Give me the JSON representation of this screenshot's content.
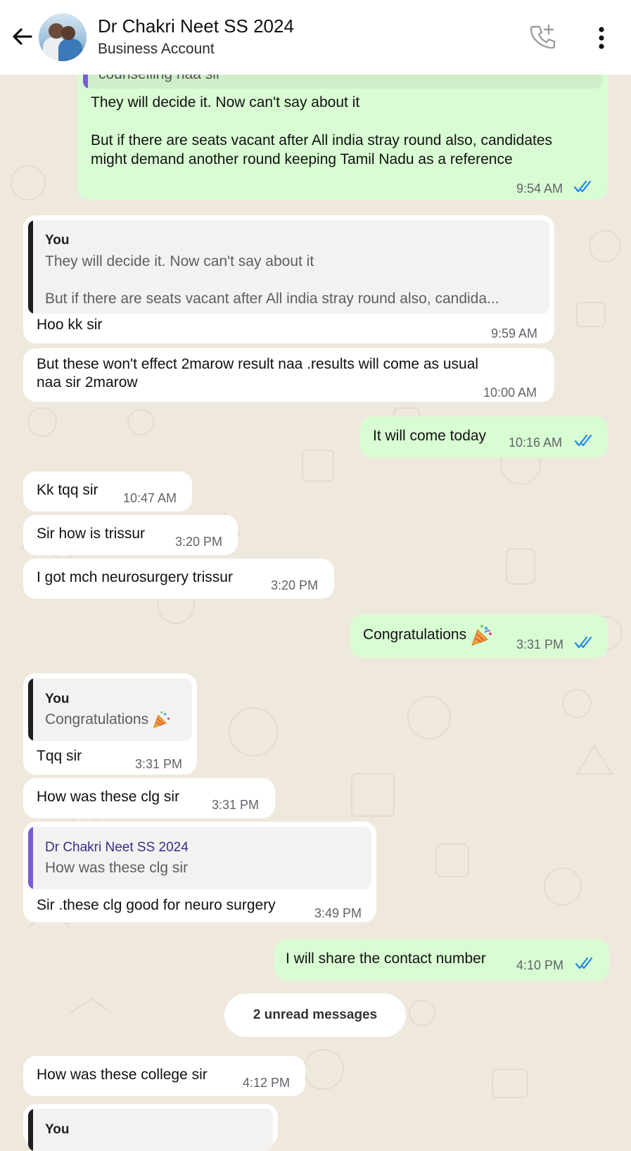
{
  "header": {
    "title": "Dr Chakri Neet SS 2024",
    "subtitle": "Business Account",
    "back_icon": "arrow-left-icon",
    "call_icon": "add-call-icon",
    "menu_icon": "more-vert-icon"
  },
  "messages": {
    "m1": {
      "quote_text_partial": "counselling naa sir",
      "line1": "They will decide it. Now can't say about it",
      "line2": "But if there are seats vacant after All india stray round also, candidates",
      "line3": "might demand another round keeping Tamil Nadu as a reference",
      "time": "9:54 AM"
    },
    "m2": {
      "quote_author": "You",
      "quote_line1": "They will decide it. Now can't say about it",
      "quote_line2": "But if there are seats vacant after All india stray round also, candida...",
      "text": "Hoo kk sir",
      "time": "9:59 AM"
    },
    "m3": {
      "line1": "But these won't effect 2marow result naa .results will come as usual",
      "line2": "naa sir 2marow",
      "time": "10:00 AM"
    },
    "m4": {
      "text": "It will come today",
      "time": "10:16 AM"
    },
    "m5": {
      "text": "Kk tqq sir",
      "time": "10:47 AM"
    },
    "m6": {
      "text": "Sir how is trissur",
      "time": "3:20 PM"
    },
    "m7": {
      "text": "I got mch neurosurgery trissur",
      "time": "3:20 PM"
    },
    "m8": {
      "text": "Congratulations",
      "time": "3:31 PM"
    },
    "m9": {
      "quote_author": "You",
      "quote_text": "Congratulations",
      "text": "Tqq sir",
      "time": "3:31 PM"
    },
    "m10": {
      "text": "How was these clg sir",
      "time": "3:31 PM"
    },
    "m11": {
      "quote_author": "Dr Chakri Neet SS 2024",
      "quote_text": "How was these clg sir",
      "text": "Sir .these clg good for neuro surgery",
      "time": "3:49 PM"
    },
    "m12": {
      "text": "I will share the contact number",
      "time": "4:10 PM"
    },
    "m13": {
      "text": "How was these college sir",
      "time": "4:12 PM"
    },
    "m14": {
      "quote_author_partial": "You"
    }
  },
  "unread_label": "2 unread messages",
  "colors": {
    "outgoing": "#d9fdd3",
    "incoming": "#ffffff",
    "read_ticks": "#53bdeb",
    "quote_you_bar": "#1f1f1f",
    "quote_contact_bar": "#7b5cd6"
  }
}
